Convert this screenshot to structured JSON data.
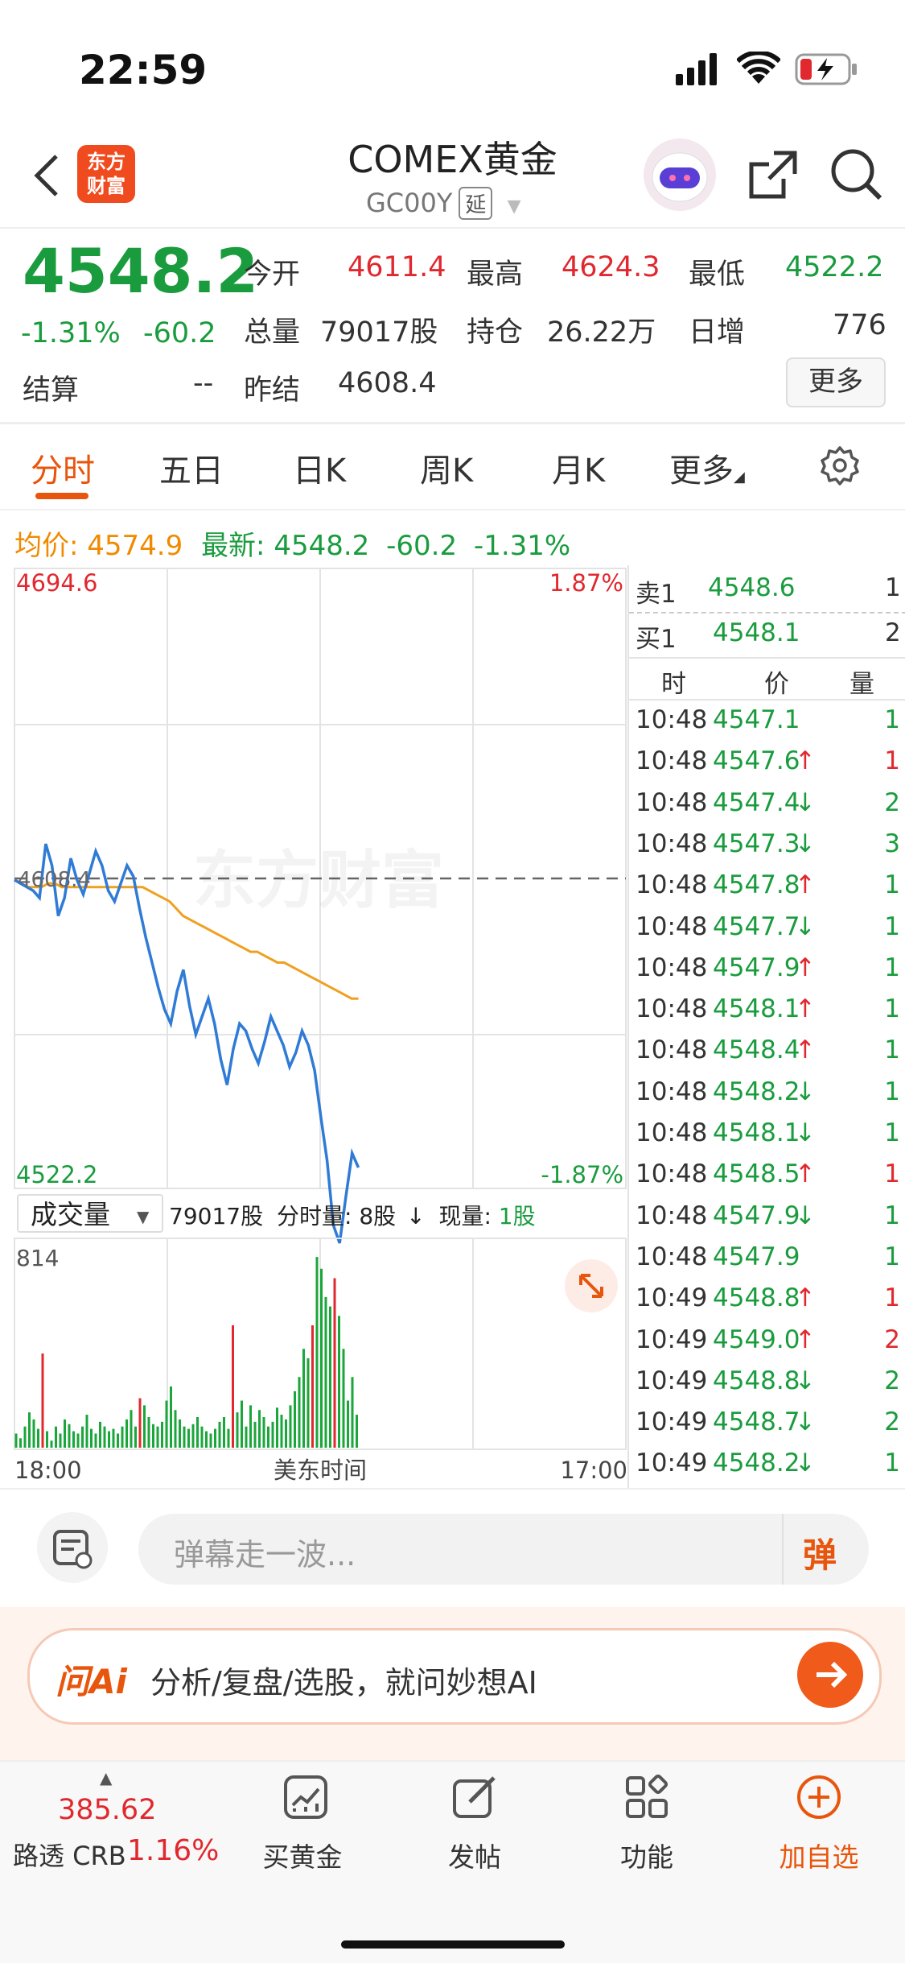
{
  "status_bar": {
    "time": "22:59"
  },
  "header": {
    "logo_text": "东方财富",
    "title": "COMEX黄金",
    "code": "GC00Y",
    "delay_tag": "延",
    "icons": [
      "back-icon",
      "robot-avatar-icon",
      "share-icon",
      "search-icon"
    ]
  },
  "quote": {
    "price": "4548.2",
    "change_pct": "-1.31%",
    "change": "-60.2",
    "fields": [
      {
        "label": "今开",
        "value": "4611.4",
        "color": "#e0282e"
      },
      {
        "label": "最高",
        "value": "4624.3",
        "color": "#e0282e"
      },
      {
        "label": "最低",
        "value": "4522.2",
        "color": "#1a9c3e"
      },
      {
        "label": "总量",
        "value": "79017股",
        "color": "#333333"
      },
      {
        "label": "持仓",
        "value": "26.22万",
        "color": "#333333"
      },
      {
        "label": "日增",
        "value": "776",
        "color": "#333333"
      },
      {
        "label": "结算",
        "value": "--",
        "color": "#333333"
      },
      {
        "label": "昨结",
        "value": "4608.4",
        "color": "#333333"
      }
    ],
    "more_button": "更多"
  },
  "tabs": [
    {
      "label": "分时",
      "active": true
    },
    {
      "label": "五日",
      "active": false
    },
    {
      "label": "日K",
      "active": false
    },
    {
      "label": "周K",
      "active": false
    },
    {
      "label": "月K",
      "active": false
    },
    {
      "label": "更多",
      "active": false
    }
  ],
  "avg_line": {
    "avg_label": "均价:",
    "avg_value": "4574.9",
    "last_label": "最新:",
    "last_value": "4548.2",
    "last_change": "-60.2",
    "last_pct": "-1.31%"
  },
  "chart_data": {
    "type": "line",
    "title": "",
    "xlabel": "美东时间",
    "x_ticks": [
      "18:00",
      "17:00"
    ],
    "ylim": [
      4522.2,
      4694.6
    ],
    "y_top_label": "4694.6",
    "y_bottom_label": "4522.2",
    "right_top_label": "1.87%",
    "right_bottom_label": "-1.87%",
    "ref_label": "4608.4",
    "prev_settle": 4608.4,
    "series": [
      {
        "name": "最新",
        "color": "#2f7bd6",
        "values": [
          4608,
          4607,
          4606,
          4605,
          4603,
          4618,
          4612,
          4598,
          4603,
          4614,
          4608,
          4604,
          4610,
          4616,
          4612,
          4605,
          4602,
          4607,
          4612,
          4609,
          4600,
          4592,
          4585,
          4578,
          4572,
          4568,
          4577,
          4583,
          4573,
          4565,
          4570,
          4575,
          4568,
          4558,
          4551,
          4561,
          4568,
          4566,
          4561,
          4557,
          4563,
          4570,
          4566,
          4562,
          4556,
          4560,
          4566,
          4562,
          4555,
          4542,
          4530,
          4512,
          4507,
          4520,
          4532,
          4528
        ]
      },
      {
        "name": "均价",
        "color": "#f0a020",
        "values": [
          4608,
          4607,
          4606,
          4606,
          4606,
          4607,
          4607,
          4606,
          4606,
          4606,
          4606,
          4606,
          4606,
          4606,
          4606,
          4606,
          4606,
          4606,
          4606,
          4606,
          4605,
          4604,
          4603,
          4602,
          4600,
          4598,
          4597,
          4596,
          4595,
          4594,
          4593,
          4592,
          4591,
          4590,
          4589,
          4588,
          4588,
          4587,
          4586,
          4585,
          4585,
          4584,
          4583,
          4582,
          4581,
          4580,
          4579,
          4578,
          4577,
          4576,
          4575,
          4575
        ]
      }
    ],
    "volume": {
      "label": "成交量",
      "total": "79017股",
      "interval_label": "分时量:",
      "interval_value": "8股",
      "current_label": "现量:",
      "current_value": "1股",
      "y_max_label": "814",
      "ymax": 814,
      "values": [
        60,
        40,
        90,
        150,
        120,
        80,
        400,
        70,
        30,
        90,
        60,
        120,
        100,
        70,
        60,
        90,
        140,
        80,
        60,
        110,
        90,
        70,
        80,
        60,
        90,
        120,
        160,
        90,
        210,
        180,
        130,
        100,
        90,
        110,
        200,
        260,
        160,
        120,
        90,
        80,
        100,
        130,
        90,
        70,
        60,
        80,
        110,
        130,
        80,
        520,
        150,
        200,
        90,
        180,
        110,
        160,
        130,
        90,
        110,
        170,
        140,
        120,
        180,
        240,
        300,
        420,
        380,
        520,
        810,
        760,
        640,
        600,
        720,
        560,
        420,
        200,
        300,
        140
      ],
      "colors_up": [
        6,
        28,
        49,
        67,
        72
      ]
    }
  },
  "order_book": {
    "sell": {
      "label": "卖1",
      "price": "4548.6",
      "qty": "1"
    },
    "buy": {
      "label": "买1",
      "price": "4548.1",
      "qty": "2"
    },
    "headers": [
      "时",
      "价",
      "量"
    ],
    "trades": [
      {
        "time": "10:48",
        "price": "4547.1",
        "dir": "",
        "qty": "1",
        "qty_color": "#1a9c3e"
      },
      {
        "time": "10:48",
        "price": "4547.6",
        "dir": "↑",
        "qty": "1",
        "qty_color": "#e0282e"
      },
      {
        "time": "10:48",
        "price": "4547.4",
        "dir": "↓",
        "qty": "2",
        "qty_color": "#1a9c3e"
      },
      {
        "time": "10:48",
        "price": "4547.3",
        "dir": "↓",
        "qty": "3",
        "qty_color": "#1a9c3e"
      },
      {
        "time": "10:48",
        "price": "4547.8",
        "dir": "↑",
        "qty": "1",
        "qty_color": "#1a9c3e"
      },
      {
        "time": "10:48",
        "price": "4547.7",
        "dir": "↓",
        "qty": "1",
        "qty_color": "#1a9c3e"
      },
      {
        "time": "10:48",
        "price": "4547.9",
        "dir": "↑",
        "qty": "1",
        "qty_color": "#1a9c3e"
      },
      {
        "time": "10:48",
        "price": "4548.1",
        "dir": "↑",
        "qty": "1",
        "qty_color": "#1a9c3e"
      },
      {
        "time": "10:48",
        "price": "4548.4",
        "dir": "↑",
        "qty": "1",
        "qty_color": "#1a9c3e"
      },
      {
        "time": "10:48",
        "price": "4548.2",
        "dir": "↓",
        "qty": "1",
        "qty_color": "#1a9c3e"
      },
      {
        "time": "10:48",
        "price": "4548.1",
        "dir": "↓",
        "qty": "1",
        "qty_color": "#1a9c3e"
      },
      {
        "time": "10:48",
        "price": "4548.5",
        "dir": "↑",
        "qty": "1",
        "qty_color": "#e0282e"
      },
      {
        "time": "10:48",
        "price": "4547.9",
        "dir": "↓",
        "qty": "1",
        "qty_color": "#1a9c3e"
      },
      {
        "time": "10:48",
        "price": "4547.9",
        "dir": "",
        "qty": "1",
        "qty_color": "#1a9c3e"
      },
      {
        "time": "10:49",
        "price": "4548.8",
        "dir": "↑",
        "qty": "1",
        "qty_color": "#e0282e"
      },
      {
        "time": "10:49",
        "price": "4549.0",
        "dir": "↑",
        "qty": "2",
        "qty_color": "#e0282e"
      },
      {
        "time": "10:49",
        "price": "4548.8",
        "dir": "↓",
        "qty": "2",
        "qty_color": "#1a9c3e"
      },
      {
        "time": "10:49",
        "price": "4548.7",
        "dir": "↓",
        "qty": "2",
        "qty_color": "#1a9c3e"
      },
      {
        "time": "10:49",
        "price": "4548.2",
        "dir": "↓",
        "qty": "1",
        "qty_color": "#1a9c3e"
      }
    ]
  },
  "comment_bar": {
    "placeholder": "弹幕走一波...",
    "danmu_button": "弹"
  },
  "ai_bar": {
    "logo": "问Ai",
    "text": "分析/复盘/选股，就问妙想AI"
  },
  "bottom_bar": {
    "index_value": "385.62",
    "index_name": "路透 CRB",
    "index_pct": "1.16%",
    "items": [
      {
        "label": "买黄金",
        "icon": "chart-up-icon"
      },
      {
        "label": "发帖",
        "icon": "edit-icon"
      },
      {
        "label": "功能",
        "icon": "grid-icon"
      },
      {
        "label": "加自选",
        "icon": "add-circle-icon"
      }
    ]
  }
}
